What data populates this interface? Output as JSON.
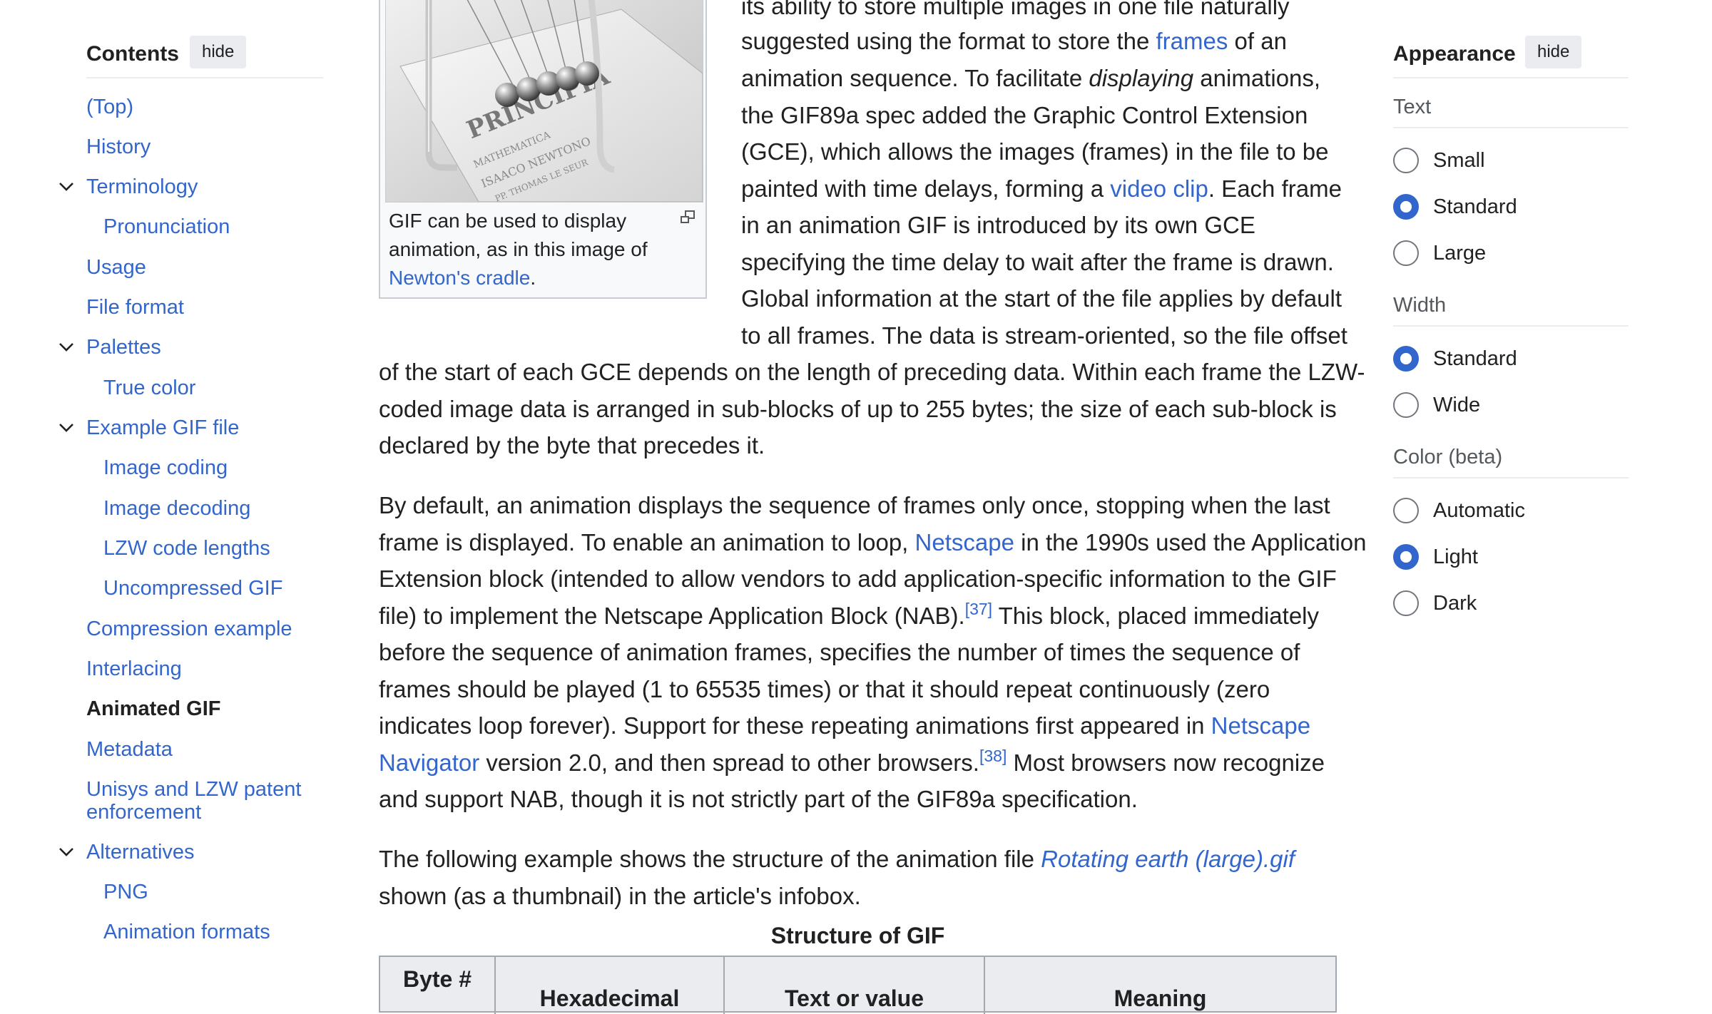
{
  "toc": {
    "title": "Contents",
    "hide_label": "hide",
    "items": [
      {
        "label": "(Top)"
      },
      {
        "label": "History"
      },
      {
        "label": "Terminology"
      },
      {
        "label": "Pronunciation"
      },
      {
        "label": "Usage"
      },
      {
        "label": "File format"
      },
      {
        "label": "Palettes"
      },
      {
        "label": "True color"
      },
      {
        "label": "Example GIF file"
      },
      {
        "label": "Image coding"
      },
      {
        "label": "Image decoding"
      },
      {
        "label": "LZW code lengths"
      },
      {
        "label": "Uncompressed GIF"
      },
      {
        "label": "Compression example"
      },
      {
        "label": "Interlacing"
      },
      {
        "label": "Animated GIF"
      },
      {
        "label": "Metadata"
      },
      {
        "label": "Unisys and LZW patent"
      },
      {
        "label": "enforcement"
      },
      {
        "label": "Alternatives"
      },
      {
        "label": "PNG"
      },
      {
        "label": "Animation formats"
      }
    ]
  },
  "figure": {
    "caption_1": "GIF can be used to display",
    "caption_2": "animation, as in this image of",
    "caption_link": "Newton's cradle",
    "caption_end": ".",
    "image_text": "PRINCIPIA"
  },
  "para1": {
    "l1": "its ability to store multiple images in one file naturally",
    "l2a": "suggested using the format to store the ",
    "l2link": "frames",
    "l2b": " of an",
    "l3a": "animation sequence. To facilitate ",
    "l3em": "displaying",
    "l3b": " animations,",
    "l4": "the GIF89a spec added the Graphic Control Extension",
    "l5": "(GCE), which allows the images (frames) in the file to be",
    "l6a": "painted with time delays, forming a ",
    "l6link": "video clip",
    "l6b": ". Each frame",
    "l7": "in an animation GIF is introduced by its own GCE",
    "l8": "specifying the time delay to wait after the frame is drawn.",
    "l9": "Global information at the start of the file applies by default",
    "l10": "to all frames. The data is stream-oriented, so the file offset",
    "l11": "of the start of each GCE depends on the length of preceding data. Within each frame the LZW-",
    "l12": "coded image data is arranged in sub-blocks of up to 255 bytes; the size of each sub-block is",
    "l13": "declared by the byte that precedes it."
  },
  "para2": {
    "l1": "By default, an animation displays the sequence of frames only once, stopping when the last",
    "l2a": "frame is displayed. To enable an animation to loop, ",
    "l2link": "Netscape",
    "l2b": " in the 1990s used the Application",
    "l3": "Extension block (intended to allow vendors to add application-specific information to the GIF",
    "l4a": "file) to implement the Netscape Application Block (NAB).",
    "l4ref": "[37]",
    "l4b": " This block, placed immediately",
    "l5": "before the sequence of animation frames, specifies the number of times the sequence of",
    "l6": "frames should be played (1 to 65535 times) or that it should repeat continuously (zero",
    "l7a": "indicates loop forever). Support for these repeating animations first appeared in ",
    "l7link": "Netscape",
    "l8link": "Navigator",
    "l8a": " version 2.0, and then spread to other browsers.",
    "l8ref": "[38]",
    "l8b": " Most browsers now recognize",
    "l9": "and support NAB, though it is not strictly part of the GIF89a specification."
  },
  "para3": {
    "l1a": "The following example shows the structure of the animation file ",
    "l1link": "Rotating earth (large).gif",
    "l2": "shown (as a thumbnail) in the article's infobox."
  },
  "table": {
    "title": "Structure of GIF",
    "headers": [
      "Byte #",
      "Hexadecimal",
      "Text or value",
      "Meaning"
    ]
  },
  "appearance": {
    "title": "Appearance",
    "hide_label": "hide",
    "text_label": "Text",
    "text_options": [
      "Small",
      "Standard",
      "Large"
    ],
    "text_selected": "Standard",
    "width_label": "Width",
    "width_options": [
      "Standard",
      "Wide"
    ],
    "width_selected": "Standard",
    "color_label": "Color (beta)",
    "color_options": [
      "Automatic",
      "Light",
      "Dark"
    ],
    "color_selected": "Light"
  }
}
